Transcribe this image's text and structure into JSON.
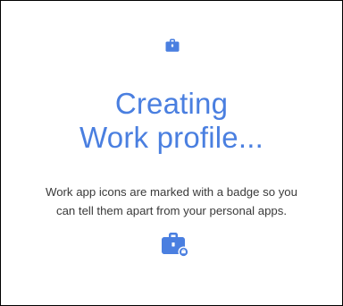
{
  "colors": {
    "accent": "#4a7fe0",
    "text": "#3a3a3a",
    "background": "#ffffff",
    "badge": "#ffffff"
  },
  "icons": {
    "top": "work-briefcase-icon",
    "bottom": "work-badge-briefcase-icon"
  },
  "title": {
    "line1": "Creating",
    "line2": "Work profile..."
  },
  "description": {
    "line1": "Work app icons are marked with a badge so you",
    "line2": "can tell them apart from your personal apps."
  }
}
